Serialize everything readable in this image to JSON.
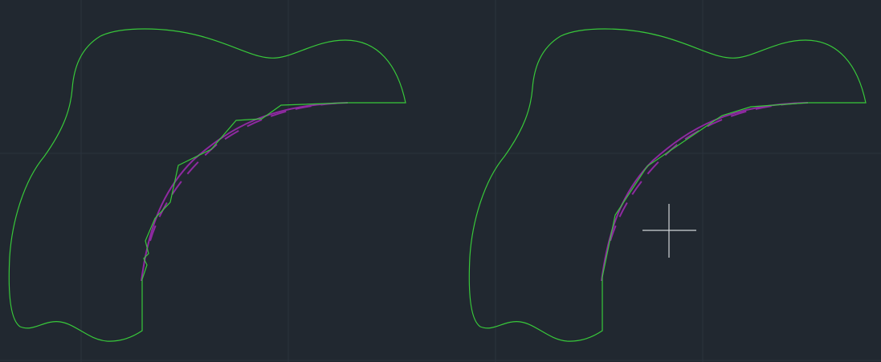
{
  "colors": {
    "background": "#212830",
    "grid_minor": "#252c35",
    "grid_major": "#2b333d",
    "outline": "#38c83a",
    "guide_curve": "#8e2aa0",
    "crosshair": "#d0d4d8"
  },
  "drawings": [
    {
      "name": "left-shape",
      "fit": "jagged-polyline"
    },
    {
      "name": "right-shape",
      "fit": "smooth-polyline"
    }
  ],
  "cursor": {
    "icon": "crosshair-cursor-icon"
  }
}
